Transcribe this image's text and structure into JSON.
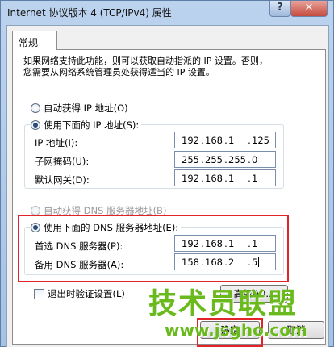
{
  "window": {
    "title": "Internet 协议版本 4 (TCP/IPv4) 属性",
    "help_label": "?",
    "close_label": "✕"
  },
  "tabs": [
    {
      "label": "常规"
    }
  ],
  "description": {
    "line1": "如果网络支持此功能，则可以获取自动指派的 IP 设置。否则，",
    "line2": "您需要从网络系统管理员处获得适当的 IP 设置。"
  },
  "ip_section": {
    "auto_label": "自动获得 IP 地址(O)",
    "manual_label": "使用下面的 IP 地址(S):",
    "selected": "manual",
    "fields": [
      {
        "label": "IP 地址(I):",
        "octets": [
          "192",
          "168",
          "1",
          "125"
        ]
      },
      {
        "label": "子网掩码(U):",
        "octets": [
          "255",
          "255",
          "255",
          "0"
        ]
      },
      {
        "label": "默认网关(D):",
        "octets": [
          "192",
          "168",
          "1",
          "1"
        ]
      }
    ]
  },
  "dns_section": {
    "auto_label": "自动获得 DNS 服务器地址(B)",
    "manual_label": "使用下面的 DNS 服务器地址(E):",
    "selected": "manual",
    "fields": [
      {
        "label": "首选 DNS 服务器(P):",
        "octets": [
          "192",
          "168",
          "1",
          "1"
        ]
      },
      {
        "label": "备用 DNS 服务器(A):",
        "octets": [
          "158",
          "168",
          "2",
          "5"
        ]
      }
    ]
  },
  "validate_on_exit": {
    "label": "退出时验证设置(L)",
    "checked": false
  },
  "buttons": {
    "advanced": "高级(V)...",
    "ok": "确定",
    "cancel": "取消"
  },
  "highlight_color": "#e2242a",
  "watermark": {
    "brand": "技术员联盟",
    "url": "www.jsgho.com"
  }
}
